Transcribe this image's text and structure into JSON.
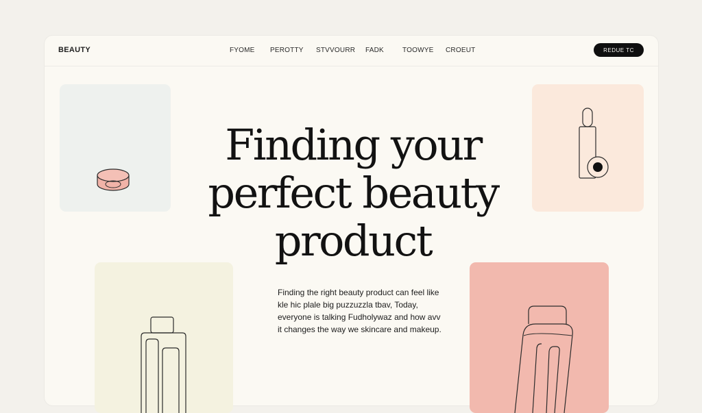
{
  "nav": {
    "brand": "BEAUTY",
    "items": [
      "FYOME",
      "PEROTTY",
      "STVVOURR",
      "FADK",
      "TOOWYE",
      "CROEUT"
    ],
    "cta_label": "REDUE TC"
  },
  "hero": {
    "title": "Finding your perfect beauty product",
    "body": "Finding the right beauty product can feel like kle hic plale big puzzuzzla tbav, Today, everyone is talking Fudholywaz and how avv it changes the way we skincare and makeup."
  },
  "colors": {
    "background": "#f3f1ec",
    "frame": "#fbf9f3",
    "card_mint": "#eef1ee",
    "card_peach": "#fbe9dc",
    "card_cream": "#f4f2e0",
    "card_rose": "#f2b9ae",
    "compact_fill": "#f1b3a8",
    "cta_bg": "#0f0f0f"
  },
  "cards": [
    {
      "name": "card-compact",
      "icon": "compact-powder-icon"
    },
    {
      "name": "card-dropper",
      "icon": "dropper-bottle-icon"
    },
    {
      "name": "card-bottle",
      "icon": "tall-bottle-icon"
    },
    {
      "name": "card-tube",
      "icon": "cream-tube-icon"
    }
  ]
}
